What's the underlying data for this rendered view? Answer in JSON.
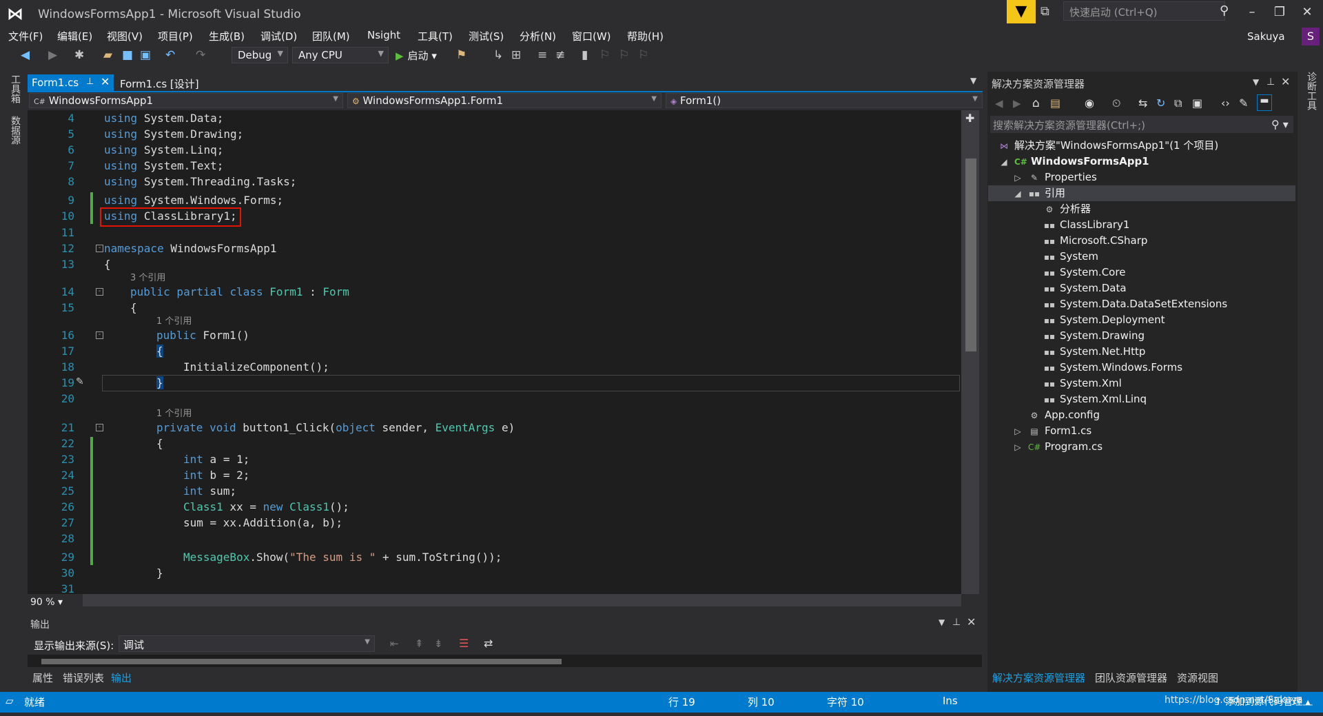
{
  "window": {
    "title": "WindowsFormsApp1 - Microsoft Visual Studio",
    "quick_launch_placeholder": "快速启动 (Ctrl+Q)",
    "user_name": "Sakuya",
    "user_initial": "S"
  },
  "menu": [
    "文件(F)",
    "编辑(E)",
    "视图(V)",
    "项目(P)",
    "生成(B)",
    "调试(D)",
    "团队(M)",
    "Nsight",
    "工具(T)",
    "测试(S)",
    "分析(N)",
    "窗口(W)",
    "帮助(H)"
  ],
  "toolbar": {
    "configuration": "Debug",
    "platform": "Any CPU",
    "start_label": "启动"
  },
  "left_strip_tabs": [
    "工具箱",
    "数据源"
  ],
  "right_strip_tabs": [
    "诊断工具"
  ],
  "tabs": {
    "active": "Form1.cs",
    "inactive": "Form1.cs [设计]"
  },
  "nav": {
    "project": "WindowsFormsApp1",
    "class": "WindowsFormsApp1.Form1",
    "member": "Form1()"
  },
  "code": {
    "lines": [
      {
        "n": "4",
        "text": "using System.Data;"
      },
      {
        "n": "5",
        "text": "using System.Drawing;"
      },
      {
        "n": "6",
        "text": "using System.Linq;"
      },
      {
        "n": "7",
        "text": "using System.Text;"
      },
      {
        "n": "8",
        "text": "using System.Threading.Tasks;"
      },
      {
        "n": "9",
        "text": "using System.Windows.Forms;"
      },
      {
        "n": "10",
        "text": "using ClassLibrary1;"
      },
      {
        "n": "11",
        "text": ""
      },
      {
        "n": "12",
        "text": "namespace WindowsFormsApp1"
      },
      {
        "n": "13",
        "text": "{"
      },
      {
        "n": "14",
        "text": "public partial class Form1 : Form"
      },
      {
        "n": "15",
        "text": "{"
      },
      {
        "n": "16",
        "text": "public Form1()"
      },
      {
        "n": "17",
        "text": "{"
      },
      {
        "n": "18",
        "text": "InitializeComponent();"
      },
      {
        "n": "19",
        "text": "}"
      },
      {
        "n": "20",
        "text": ""
      },
      {
        "n": "21",
        "text": "private void button1_Click(object sender, EventArgs e)"
      },
      {
        "n": "22",
        "text": "{"
      },
      {
        "n": "23",
        "text": "int a = 1;"
      },
      {
        "n": "24",
        "text": "int b = 2;"
      },
      {
        "n": "25",
        "text": "int sum;"
      },
      {
        "n": "26",
        "text": "Class1 xx = new Class1();"
      },
      {
        "n": "27",
        "text": "sum = xx.Addition(a, b);"
      },
      {
        "n": "28",
        "text": ""
      },
      {
        "n": "29",
        "text": "MessageBox.Show(\"The sum is \" + sum.ToString());"
      },
      {
        "n": "30",
        "text": "}"
      },
      {
        "n": "31",
        "text": "}"
      }
    ],
    "ref_class": "3 个引用",
    "ref_ctor": "1 个引用",
    "ref_click": "1 个引用"
  },
  "editor_zoom": "90 %",
  "output": {
    "title": "输出",
    "source_label": "显示输出来源(S):",
    "source_value": "调试"
  },
  "bottom_tabs": [
    "属性",
    "错误列表",
    "输出"
  ],
  "solution_explorer": {
    "title": "解决方案资源管理器",
    "search_placeholder": "搜索解决方案资源管理器(Ctrl+;)",
    "solution": "解决方案\"WindowsFormsApp1\"(1 个项目)",
    "project": "WindowsFormsApp1",
    "properties": "Properties",
    "references": "引用",
    "ref_items": [
      "分析器",
      "ClassLibrary1",
      "Microsoft.CSharp",
      "System",
      "System.Core",
      "System.Data",
      "System.Data.DataSetExtensions",
      "System.Deployment",
      "System.Drawing",
      "System.Net.Http",
      "System.Windows.Forms",
      "System.Xml",
      "System.Xml.Linq"
    ],
    "files": [
      "App.config",
      "Form1.cs",
      "Program.cs"
    ],
    "tabs": [
      "解决方案资源管理器",
      "团队资源管理器",
      "资源视图"
    ]
  },
  "status": {
    "ready": "就绪",
    "line": "行 19",
    "col": "列 10",
    "char": "字符 10",
    "mode": "Ins",
    "watermark": "https://blog.csdn.net/Sakuya__",
    "source_control": "添加到源代码管理"
  },
  "colors": {
    "accent": "#007acc",
    "keyword": "#569cd6",
    "type": "#4ec9b0",
    "string": "#d69d85",
    "line_number": "#2b91af",
    "highlight_box": "#e51400"
  }
}
